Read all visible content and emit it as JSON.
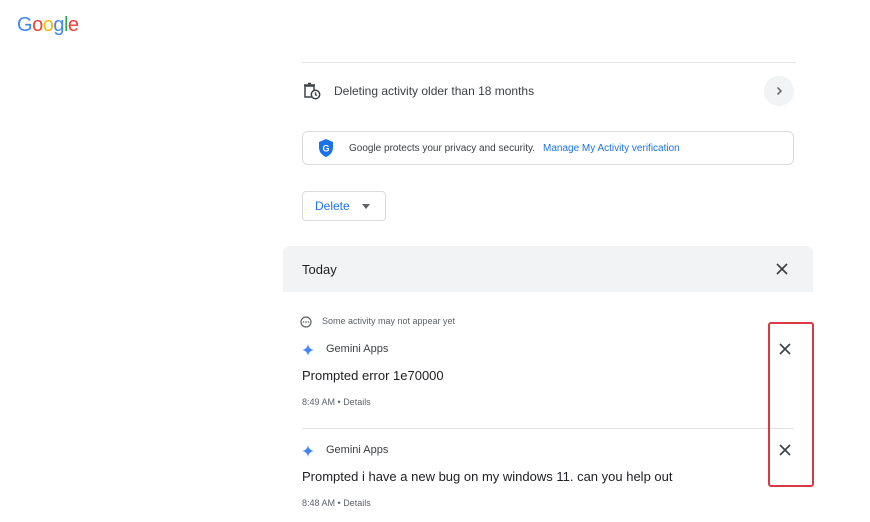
{
  "logo": {
    "letters": [
      {
        "char": "G",
        "color": "#4285F4"
      },
      {
        "char": "o",
        "color": "#EA4335"
      },
      {
        "char": "o",
        "color": "#FBBC05"
      },
      {
        "char": "g",
        "color": "#4285F4"
      },
      {
        "char": "l",
        "color": "#34A853"
      },
      {
        "char": "e",
        "color": "#EA4335"
      }
    ]
  },
  "auto_delete": {
    "icon": "auto-delete-icon",
    "text": "Deleting activity older than 18 months",
    "chevron_icon": "chevron-right-icon"
  },
  "privacy_banner": {
    "icon": "google-shield-icon",
    "text": "Google protects your privacy and security.",
    "link": "Manage My Activity verification"
  },
  "delete_menu": {
    "label": "Delete",
    "icon": "caret-down-icon"
  },
  "section": {
    "title": "Today",
    "close_icon": "close-icon"
  },
  "notice": {
    "icon": "pending-icon",
    "text": "Some activity may not appear yet"
  },
  "activities": [
    {
      "app": "Gemini Apps",
      "prompt": "Prompted error 1e70000",
      "time": "8:49 AM",
      "details": "Details"
    },
    {
      "app": "Gemini Apps",
      "prompt": "Prompted i have a new bug on my windows 11. can you help out",
      "time": "8:48 AM",
      "details": "Details"
    }
  ],
  "colors": {
    "accent": "#1a73e8",
    "highlight_box": "#d93844",
    "gemini": "#4285F4"
  }
}
